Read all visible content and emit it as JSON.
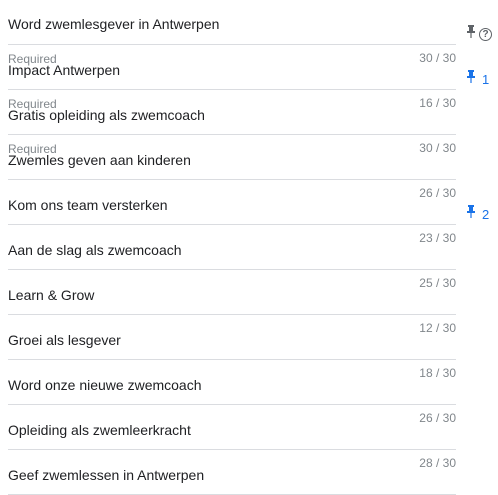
{
  "header": {
    "text": "Word zwemlesgever in Antwerpen",
    "help_glyph": "?"
  },
  "rows": [
    {
      "required": "Required",
      "text": "Impact Antwerpen",
      "count": "30 / 30"
    },
    {
      "required": "Required",
      "text": "Gratis opleiding als zwemcoach",
      "count": "16 / 30"
    },
    {
      "required": "Required",
      "text": "Zwemles geven aan kinderen",
      "count": "30 / 30"
    },
    {
      "required": "",
      "text": "Kom ons team versterken",
      "count": "26 / 30"
    },
    {
      "required": "",
      "text": "Aan de slag als zwemcoach",
      "count": "23 / 30"
    },
    {
      "required": "",
      "text": "Learn & Grow",
      "count": "25 / 30"
    },
    {
      "required": "",
      "text": "Groei als lesgever",
      "count": "12 / 30"
    },
    {
      "required": "",
      "text": "Word onze nieuwe zwemcoach",
      "count": "18 / 30"
    },
    {
      "required": "",
      "text": "Opleiding als zwemleerkracht",
      "count": "26 / 30"
    },
    {
      "required": "",
      "text": "Geef zwemlessen in Antwerpen",
      "count": "28 / 30"
    }
  ],
  "pins": [
    {
      "label": "1"
    },
    {
      "label": "2"
    }
  ],
  "colors": {
    "pin_blue": "#1a73e8",
    "pin_gray": "#5f6368",
    "divider": "#dadce0",
    "muted_text": "#80868b"
  },
  "icons": [
    "pin-icon",
    "help-icon"
  ]
}
